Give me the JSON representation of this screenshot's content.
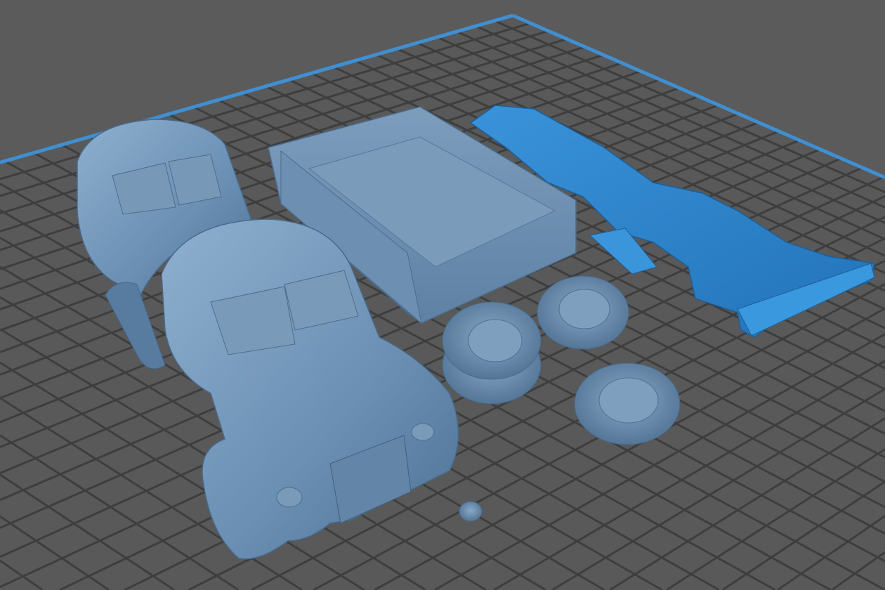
{
  "viewport": {
    "background_color": "#5b5b5b",
    "plate_color": "#595959",
    "grid_line_color": "#3e3e3e",
    "plate_edge_color": "#3f8fd2",
    "model_color": "#6f93b6",
    "model_shadow_color": "#4d6e8e",
    "selected_model_color": "#2f87cf"
  }
}
